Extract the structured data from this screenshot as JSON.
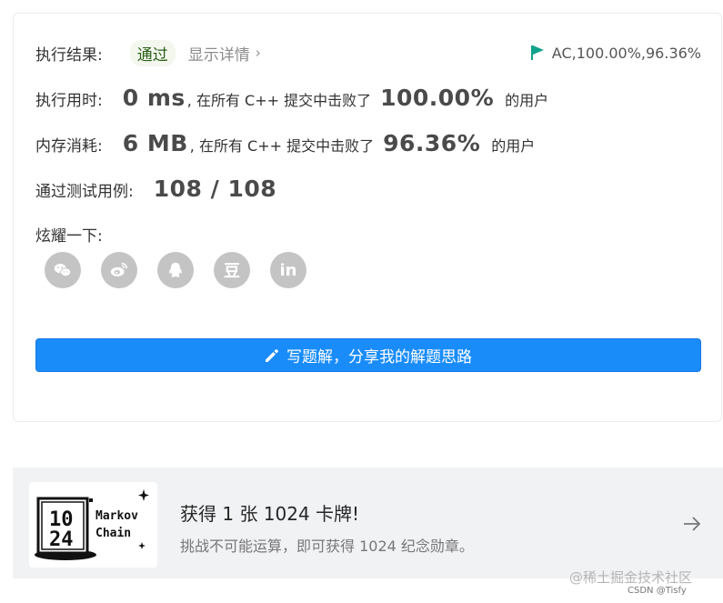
{
  "result": {
    "label": "执行结果:",
    "status": "通过",
    "details_link": "显示详情",
    "chevron": "›",
    "ac_summary": "AC,100.00%,96.36%",
    "flag_color": "#11a28c"
  },
  "runtime": {
    "label": "执行用时:",
    "value": "0 ms",
    "middle": ", 在所有 C++ 提交中击败了",
    "percent": "100.00%",
    "suffix": "的用户"
  },
  "memory": {
    "label": "内存消耗:",
    "value": "6 MB",
    "middle": ", 在所有 C++ 提交中击败了",
    "percent": "96.36%",
    "suffix": "的用户"
  },
  "tests": {
    "label": "通过测试用例:",
    "value": "108 / 108"
  },
  "share": {
    "label": "炫耀一下:",
    "icons": [
      "wechat-icon",
      "weibo-icon",
      "qq-icon",
      "douban-icon",
      "linkedin-icon"
    ],
    "douban_glyph": "豆",
    "linkedin_glyph": "in"
  },
  "write_button": {
    "label": "写题解，分享我的解题思路",
    "color": "#1a8cfa"
  },
  "promo": {
    "title": "获得 1 张 1024 卡牌!",
    "subtitle": "挑战不可能运算，即可获得 1024 纪念勋章。",
    "card_text_line1": "Markov",
    "card_text_line2": "Chain"
  },
  "watermark": {
    "text": "@稀土掘金技术社区",
    "csdn": "CSDN @Tisfy"
  }
}
